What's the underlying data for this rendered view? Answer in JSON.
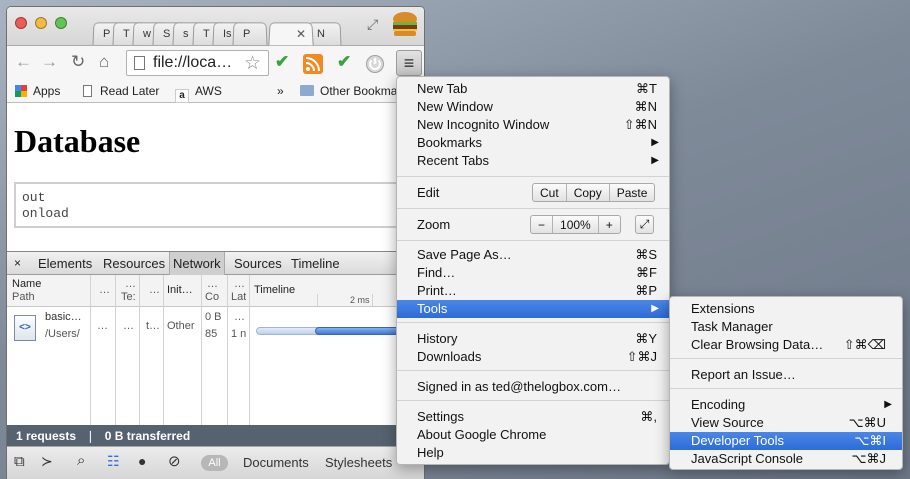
{
  "browser": {
    "tabs": [
      "P",
      "T",
      "w",
      "S",
      "s",
      "T",
      "Is",
      "P",
      "",
      "N"
    ],
    "address": "file://loca…",
    "bookmarks": {
      "apps": "Apps",
      "read_later": "Read Later",
      "aws": "AWS",
      "overflow": "»",
      "other": "Other Bookma"
    }
  },
  "page": {
    "title": "Database",
    "output_lines": [
      "out",
      "onload"
    ]
  },
  "devtools": {
    "close": "×",
    "tabs": [
      "Elements",
      "Resources",
      "Network",
      "Sources",
      "Timeline"
    ],
    "columns": {
      "name": "Name",
      "path": "Path",
      "c2": "…",
      "c3a": "…",
      "c3b": "Te:",
      "c4": "…",
      "c5": "Init…",
      "c6a": "…",
      "c6b": "Co",
      "c7a": "…",
      "c7b": "Lat",
      "timeline": "Timeline",
      "tick": "2 ms"
    },
    "row": {
      "name": "basic…",
      "path": "/Users/",
      "c2": "…",
      "c3": "…",
      "c4": "t…",
      "initiator": "Other",
      "size1": "0 B",
      "size2": "85",
      "lat1": "…",
      "lat2": "1 n",
      "icon": "<>"
    },
    "status": {
      "requests": "1 requests",
      "divider": "❘",
      "transferred": "0 B transferred"
    },
    "bottom": {
      "all": "All",
      "documents": "Documents",
      "stylesheets": "Stylesheets"
    }
  },
  "menu": {
    "new_tab": {
      "label": "New Tab",
      "shortcut": "⌘T"
    },
    "new_window": {
      "label": "New Window",
      "shortcut": "⌘N"
    },
    "new_incognito": {
      "label": "New Incognito Window",
      "shortcut": "⇧⌘N"
    },
    "bookmarks": {
      "label": "Bookmarks"
    },
    "recent_tabs": {
      "label": "Recent Tabs"
    },
    "edit": {
      "label": "Edit",
      "cut": "Cut",
      "copy": "Copy",
      "paste": "Paste"
    },
    "zoom": {
      "label": "Zoom",
      "minus": "−",
      "value": "100%",
      "plus": "+"
    },
    "save_page": {
      "label": "Save Page As…",
      "shortcut": "⌘S"
    },
    "find": {
      "label": "Find…",
      "shortcut": "⌘F"
    },
    "print": {
      "label": "Print…",
      "shortcut": "⌘P"
    },
    "tools": {
      "label": "Tools"
    },
    "history": {
      "label": "History",
      "shortcut": "⌘Y"
    },
    "downloads": {
      "label": "Downloads",
      "shortcut": "⇧⌘J"
    },
    "signed_in": {
      "label": "Signed in as ted@thelogbox.com…"
    },
    "settings": {
      "label": "Settings",
      "shortcut": "⌘,"
    },
    "about": {
      "label": "About Google Chrome"
    },
    "help": {
      "label": "Help"
    }
  },
  "tools_submenu": {
    "extensions": {
      "label": "Extensions"
    },
    "task_manager": {
      "label": "Task Manager"
    },
    "clear_data": {
      "label": "Clear Browsing Data…",
      "shortcut": "⇧⌘⌫"
    },
    "report_issue": {
      "label": "Report an Issue…"
    },
    "encoding": {
      "label": "Encoding"
    },
    "view_source": {
      "label": "View Source",
      "shortcut": "⌥⌘U"
    },
    "developer_tools": {
      "label": "Developer Tools",
      "shortcut": "⌥⌘I"
    },
    "js_console": {
      "label": "JavaScript Console",
      "shortcut": "⌥⌘J"
    }
  },
  "colors": {
    "highlight": "#2d6bd8",
    "status_bar": "#56626f",
    "check_green": "#3aa33a",
    "rss_orange": "#f08a24"
  }
}
